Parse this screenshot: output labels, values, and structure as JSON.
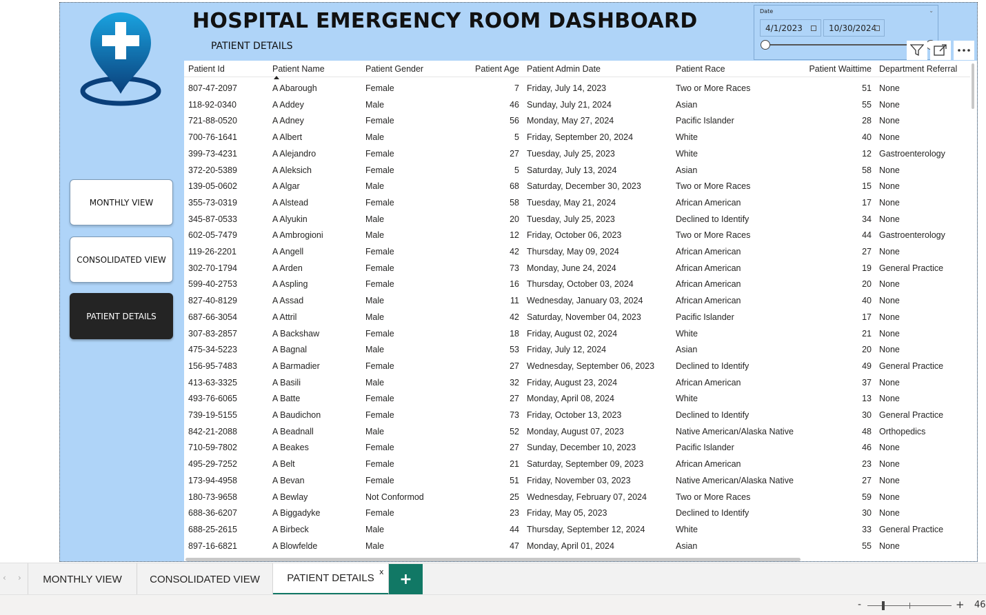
{
  "header": {
    "title": "HOSPITAL EMERGENCY ROOM DASHBOARD",
    "subtitle": "PATIENT DETAILS"
  },
  "nav_buttons": {
    "monthly": "MONTHLY VIEW",
    "consolidated": "CONSOLIDATED VIEW",
    "patient_details": "PATIENT DETAILS"
  },
  "date_slicer": {
    "label": "Date",
    "start": "4/1/2023",
    "end": "10/30/2024",
    "range_start_fraction": 0,
    "range_end_fraction": 1
  },
  "visual_header_icons": [
    "filter-icon",
    "focus-mode-icon",
    "more-options-icon"
  ],
  "table": {
    "columns": [
      "Patient Id",
      "Patient Name",
      "Patient Gender",
      "Patient Age",
      "Patient Admin Date",
      "Patient Race",
      "Patient Waittime",
      "Department Referral"
    ],
    "sorted_column": "Patient Name",
    "rows": [
      [
        "807-47-2097",
        "A Abarough",
        "Female",
        "7",
        "Friday, July 14, 2023",
        "Two or More Races",
        "51",
        "None"
      ],
      [
        "118-92-0340",
        "A Addey",
        "Male",
        "46",
        "Sunday, July 21, 2024",
        "Asian",
        "55",
        "None"
      ],
      [
        "721-88-0520",
        "A Adney",
        "Female",
        "56",
        "Monday, May 27, 2024",
        "Pacific Islander",
        "28",
        "None"
      ],
      [
        "700-76-1641",
        "A Albert",
        "Male",
        "5",
        "Friday, September 20, 2024",
        "White",
        "40",
        "None"
      ],
      [
        "399-73-4231",
        "A Alejandro",
        "Female",
        "27",
        "Tuesday, July 25, 2023",
        "White",
        "12",
        "Gastroenterology"
      ],
      [
        "372-20-5389",
        "A Aleksich",
        "Female",
        "5",
        "Saturday, July 13, 2024",
        "Asian",
        "58",
        "None"
      ],
      [
        "139-05-0602",
        "A Algar",
        "Male",
        "68",
        "Saturday, December 30, 2023",
        "Two or More Races",
        "15",
        "None"
      ],
      [
        "355-73-0319",
        "A Alstead",
        "Female",
        "58",
        "Tuesday, May 21, 2024",
        "African American",
        "17",
        "None"
      ],
      [
        "345-87-0533",
        "A Alyukin",
        "Male",
        "20",
        "Tuesday, July 25, 2023",
        "Declined to Identify",
        "34",
        "None"
      ],
      [
        "602-05-7479",
        "A Ambrogioni",
        "Male",
        "12",
        "Friday, October 06, 2023",
        "Two or More Races",
        "44",
        "Gastroenterology"
      ],
      [
        "119-26-2201",
        "A Angell",
        "Female",
        "42",
        "Thursday, May 09, 2024",
        "African American",
        "27",
        "None"
      ],
      [
        "302-70-1794",
        "A Arden",
        "Female",
        "73",
        "Monday, June 24, 2024",
        "African American",
        "19",
        "General Practice"
      ],
      [
        "599-40-2753",
        "A Aspling",
        "Female",
        "16",
        "Thursday, October 03, 2024",
        "African American",
        "20",
        "None"
      ],
      [
        "827-40-8129",
        "A Assad",
        "Male",
        "11",
        "Wednesday, January 03, 2024",
        "African American",
        "40",
        "None"
      ],
      [
        "687-66-3054",
        "A Attril",
        "Male",
        "42",
        "Saturday, November 04, 2023",
        "Pacific Islander",
        "17",
        "None"
      ],
      [
        "307-83-2857",
        "A Backshaw",
        "Female",
        "18",
        "Friday, August 02, 2024",
        "White",
        "21",
        "None"
      ],
      [
        "475-34-5223",
        "A Bagnal",
        "Male",
        "53",
        "Friday, July 12, 2024",
        "Asian",
        "20",
        "None"
      ],
      [
        "156-95-7483",
        "A Barmadier",
        "Female",
        "27",
        "Wednesday, September 06, 2023",
        "Declined to Identify",
        "49",
        "General Practice"
      ],
      [
        "413-63-3325",
        "A Basili",
        "Male",
        "32",
        "Friday, August 23, 2024",
        "African American",
        "37",
        "None"
      ],
      [
        "493-76-6065",
        "A Batte",
        "Female",
        "27",
        "Monday, April 08, 2024",
        "White",
        "13",
        "None"
      ],
      [
        "739-19-5155",
        "A Baudichon",
        "Female",
        "73",
        "Friday, October 13, 2023",
        "Declined to Identify",
        "30",
        "General Practice"
      ],
      [
        "842-21-2088",
        "A Beadnall",
        "Male",
        "52",
        "Monday, August 07, 2023",
        "Native American/Alaska Native",
        "48",
        "Orthopedics"
      ],
      [
        "710-59-7802",
        "A Beakes",
        "Female",
        "27",
        "Sunday, December 10, 2023",
        "Pacific Islander",
        "46",
        "None"
      ],
      [
        "495-29-7252",
        "A Belt",
        "Female",
        "21",
        "Saturday, September 09, 2023",
        "African American",
        "23",
        "None"
      ],
      [
        "173-94-4958",
        "A Bevan",
        "Female",
        "51",
        "Friday, November 03, 2023",
        "Native American/Alaska Native",
        "27",
        "None"
      ],
      [
        "180-73-9658",
        "A Bewlay",
        "Not Conformod",
        "25",
        "Wednesday, February 07, 2024",
        "Two or More Races",
        "59",
        "None"
      ],
      [
        "688-36-6207",
        "A Biggadyke",
        "Female",
        "23",
        "Friday, May 05, 2023",
        "Declined to Identify",
        "30",
        "None"
      ],
      [
        "688-25-2615",
        "A Birbeck",
        "Male",
        "44",
        "Thursday, September 12, 2024",
        "White",
        "33",
        "General Practice"
      ],
      [
        "897-16-6821",
        "A Blowfelde",
        "Male",
        "47",
        "Monday, April 01, 2024",
        "Asian",
        "55",
        "None"
      ]
    ]
  },
  "page_tabs": {
    "tab1": "MONTHLY VIEW",
    "tab2": "CONSOLIDATED VIEW",
    "tab3": "PATIENT DETAILS",
    "close": "x",
    "add": "+"
  },
  "status_bar": {
    "zoom_minus": "-",
    "zoom_plus": "+",
    "zoom_value": "46"
  },
  "colors": {
    "canvas_bg": "#afd4f8",
    "active_button_bg": "#242424",
    "accent_green": "#117865",
    "logo_blue": "#0d7fc4"
  }
}
